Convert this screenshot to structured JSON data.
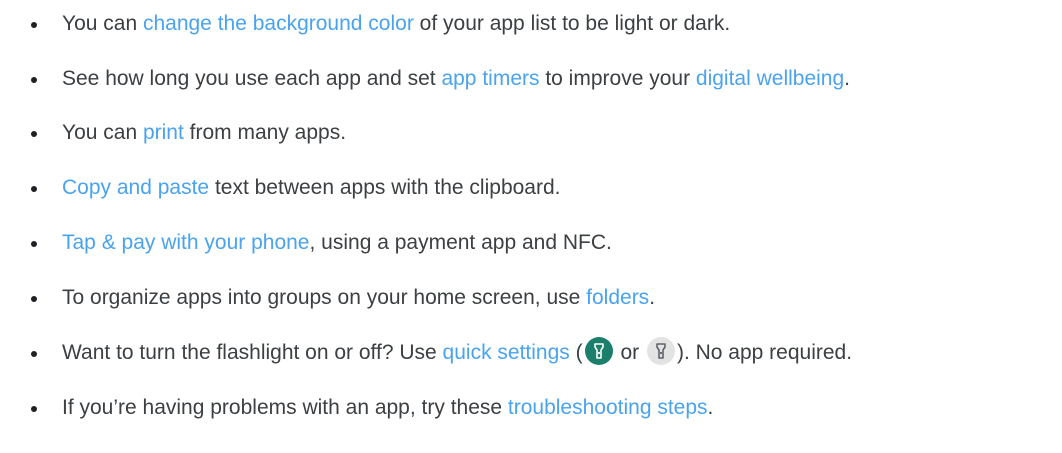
{
  "tips": {
    "t1": {
      "a": "You can ",
      "link": "change the background color",
      "b": " of your app list to be light or dark."
    },
    "t2": {
      "a": "See how long you use each app and set ",
      "link1": "app timers",
      "b": " to improve your ",
      "link2": "digital wellbeing",
      "c": "."
    },
    "t3": {
      "a": "You can ",
      "link": "print",
      "b": " from many apps."
    },
    "t4": {
      "link": "Copy and paste",
      "b": " text between apps with the clipboard."
    },
    "t5": {
      "link": "Tap & pay with your phone",
      "b": ", using a payment app and NFC."
    },
    "t6": {
      "a": "To organize apps into groups on your home screen, use ",
      "link": "folders",
      "b": "."
    },
    "t7": {
      "a": "Want to turn the flashlight on or off? Use ",
      "link": "quick settings",
      "b": " (",
      "c": " or ",
      "d": "). No app required."
    },
    "t8": {
      "a": "If you’re having problems with an app, try these ",
      "link": "troubleshooting steps",
      "b": "."
    }
  },
  "icons": {
    "flashlight_on": "flashlight-on-icon",
    "flashlight_off": "flashlight-off-icon"
  },
  "colors": {
    "link": "#4aa3ee",
    "text": "#3c4043",
    "flashlight_on_bg": "#1b7f6c",
    "flashlight_off_bg": "#e3e3e3"
  }
}
